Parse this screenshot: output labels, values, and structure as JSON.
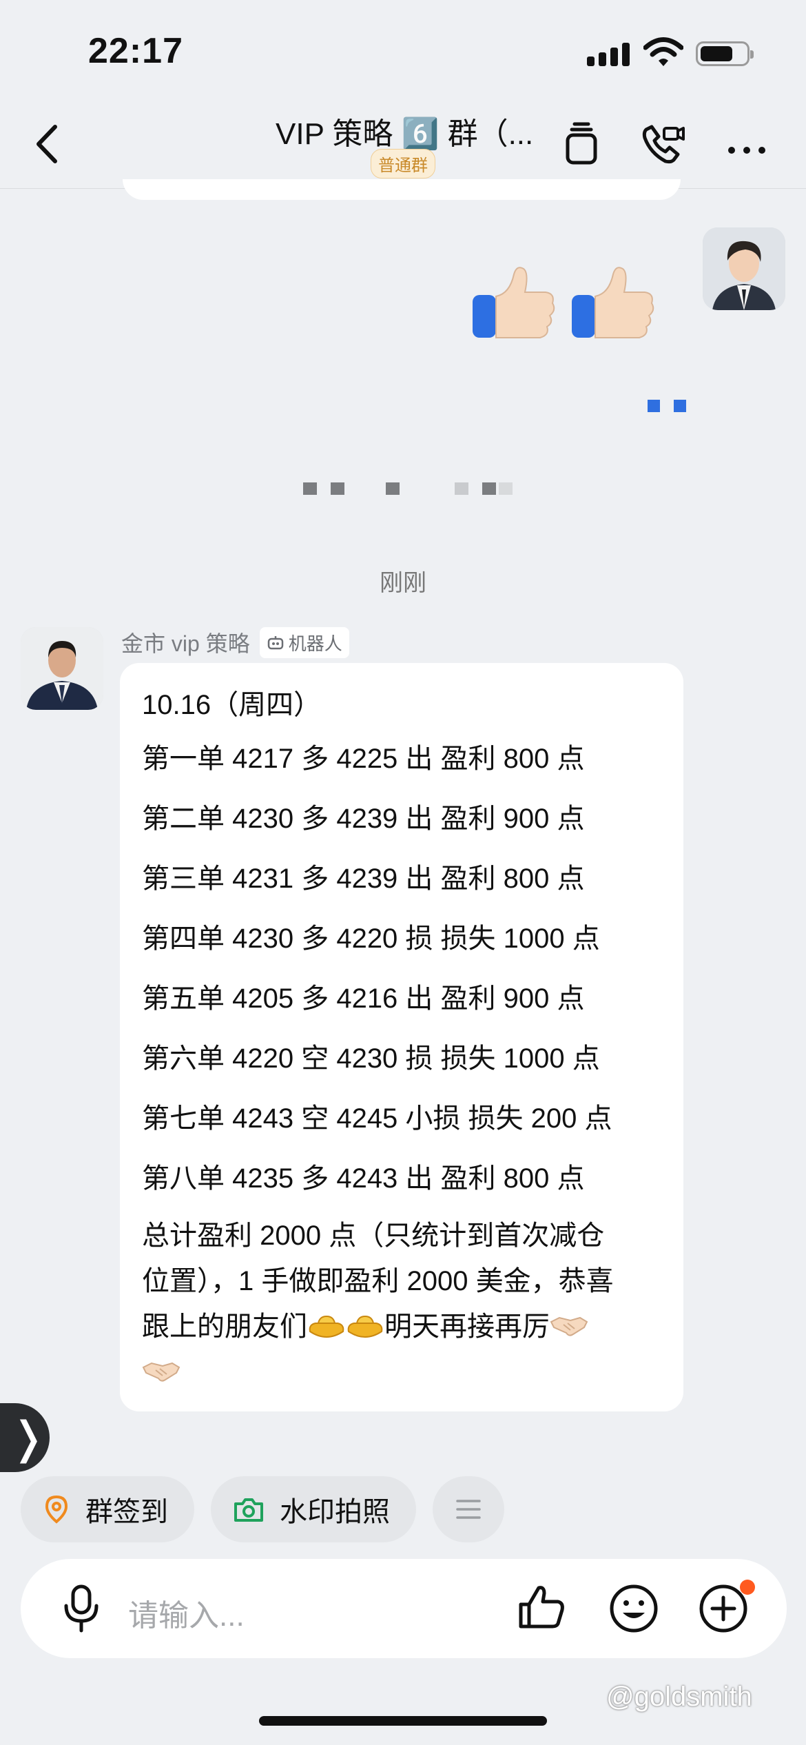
{
  "status_bar": {
    "time": "22:17",
    "battery_level": 0.7
  },
  "nav": {
    "title": "VIP 策略 6️⃣ 群（...",
    "badge": "普通群"
  },
  "chat": {
    "timestamp": "刚刚",
    "sender": {
      "name": "金市 vip 策略",
      "tag": "机器人"
    },
    "message": {
      "date_line": "10.16（周四）",
      "lines": [
        "第一单 4217 多 4225 出 盈利 800 点",
        "第二单 4230 多 4239 出 盈利 900 点",
        "第三单 4231 多 4239 出 盈利 800 点",
        "第四单 4230 多 4220 损 损失 1000 点",
        "第五单 4205 多 4216 出 盈利 900 点",
        "第六单 4220 空 4230 损 损失 1000 点",
        "第七单 4243 空 4245 小损 损失 200 点",
        "第八单 4235 多 4243 出 盈利 800 点"
      ],
      "summary_1": "总计盈利 2000 点（只统计到首次减仓",
      "summary_2": "位置），1 手做即盈利 2000 美金，恭喜",
      "summary_3a": "跟上的朋友们",
      "summary_3b": "明天再接再厉",
      "emoji_gold": "gold-ingot-emoji",
      "emoji_handshake": "handshake-emoji"
    }
  },
  "quick_actions": {
    "checkin": "群签到",
    "watermark_photo": "水印拍照"
  },
  "input": {
    "placeholder": "请输入..."
  },
  "watermark": "@goldsmith",
  "colors": {
    "background": "#eef0f3",
    "accent_orange": "#ff5a1f",
    "badge_gold": "#c98a2a"
  }
}
